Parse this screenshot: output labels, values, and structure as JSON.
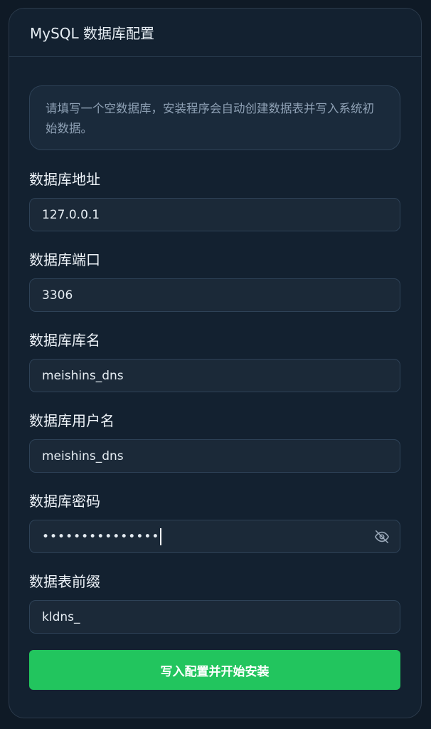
{
  "card": {
    "title": "MySQL 数据库配置",
    "notice": "请填写一个空数据库，安装程序会自动创建数据表并写入系统初始数据。"
  },
  "fields": {
    "host": {
      "label": "数据库地址",
      "value": "127.0.0.1"
    },
    "port": {
      "label": "数据库端口",
      "value": "3306"
    },
    "name": {
      "label": "数据库库名",
      "value": "meishins_dns"
    },
    "user": {
      "label": "数据库用户名",
      "value": "meishins_dns"
    },
    "password": {
      "label": "数据库密码",
      "value": "•••••••••••••••"
    },
    "prefix": {
      "label": "数据表前缀",
      "value": "kldns_"
    }
  },
  "icons": {
    "password_toggle": "eye-off-icon"
  },
  "colors": {
    "accent": "#22c55e",
    "background": "#0f1a26",
    "card": "#132130"
  },
  "submit": {
    "label": "写入配置并开始安装"
  }
}
